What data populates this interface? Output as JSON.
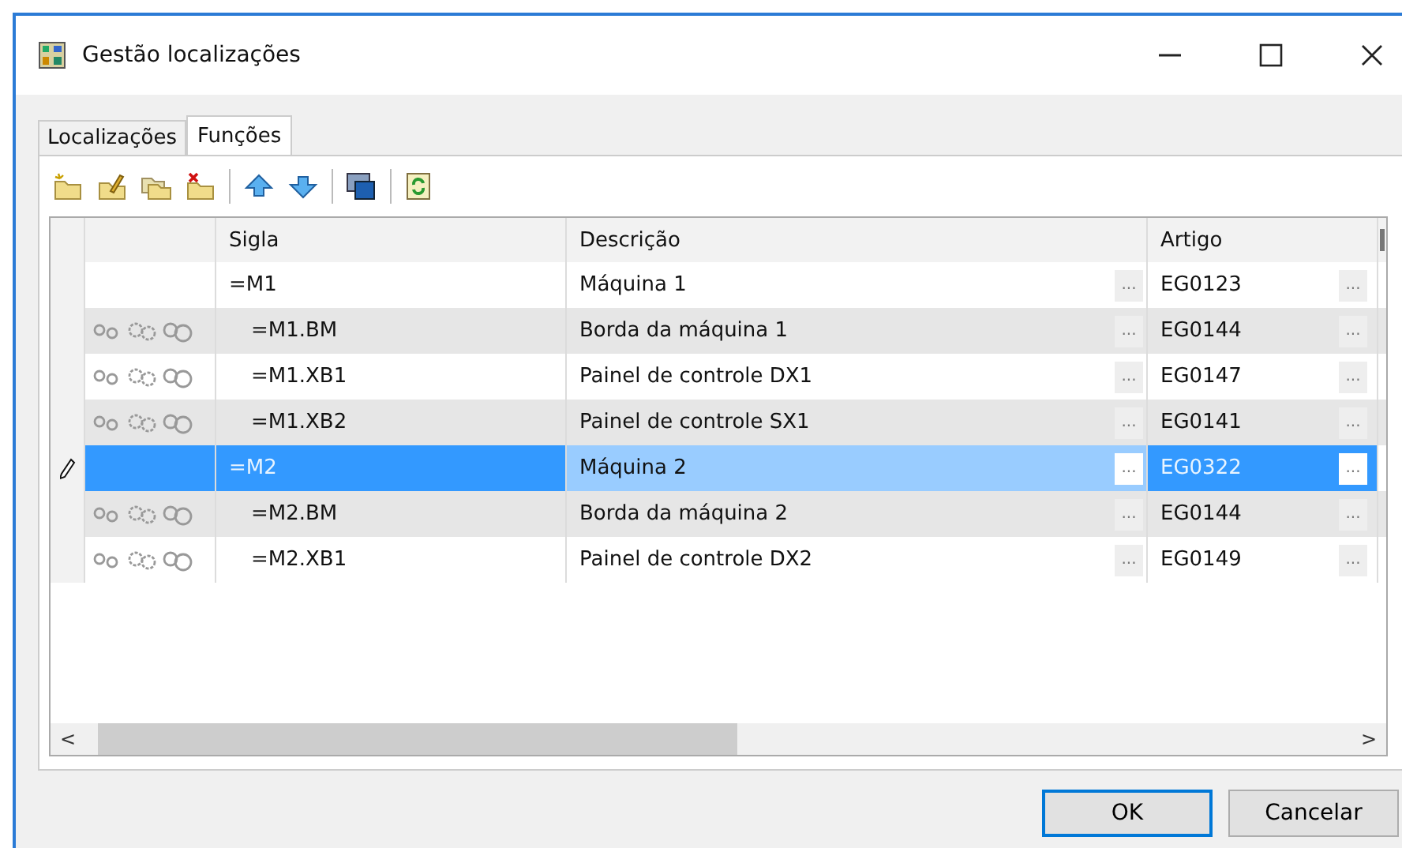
{
  "window": {
    "title": "Gestão localizações"
  },
  "tabs": [
    {
      "label": "Localizações",
      "selected": false
    },
    {
      "label": "Funções",
      "selected": true
    }
  ],
  "table": {
    "columns": [
      "Sigla",
      "Descrição",
      "Artigo"
    ],
    "rows": [
      {
        "sigla": "=M1",
        "descricao": "Máquina 1",
        "artigo": "EG0123",
        "selected": false,
        "children": [
          {
            "sigla": "=M1.BM",
            "descricao": "Borda da máquina 1",
            "artigo": "EG0144",
            "selected": false
          },
          {
            "sigla": "=M1.XB1",
            "descricao": "Painel de controle DX1",
            "artigo": "EG0147",
            "selected": false
          },
          {
            "sigla": "=M1.XB2",
            "descricao": "Painel de controle SX1",
            "artigo": "EG0141",
            "selected": false
          }
        ]
      },
      {
        "sigla": "=M2",
        "descricao": "Máquina 2",
        "artigo": "EG0322",
        "selected": true,
        "children": [
          {
            "sigla": "=M2.BM",
            "descricao": "Borda da máquina 2",
            "artigo": "EG0144",
            "selected": false
          },
          {
            "sigla": "=M2.XB1",
            "descricao": "Painel de controle DX2",
            "artigo": "EG0149",
            "selected": false
          }
        ]
      }
    ]
  },
  "ellipsis": "...",
  "scroll_left": "<",
  "scroll_right": ">",
  "buttons": [
    {
      "label": "OK",
      "kind": "default"
    },
    {
      "label": "Cancelar",
      "kind": "normal"
    }
  ]
}
